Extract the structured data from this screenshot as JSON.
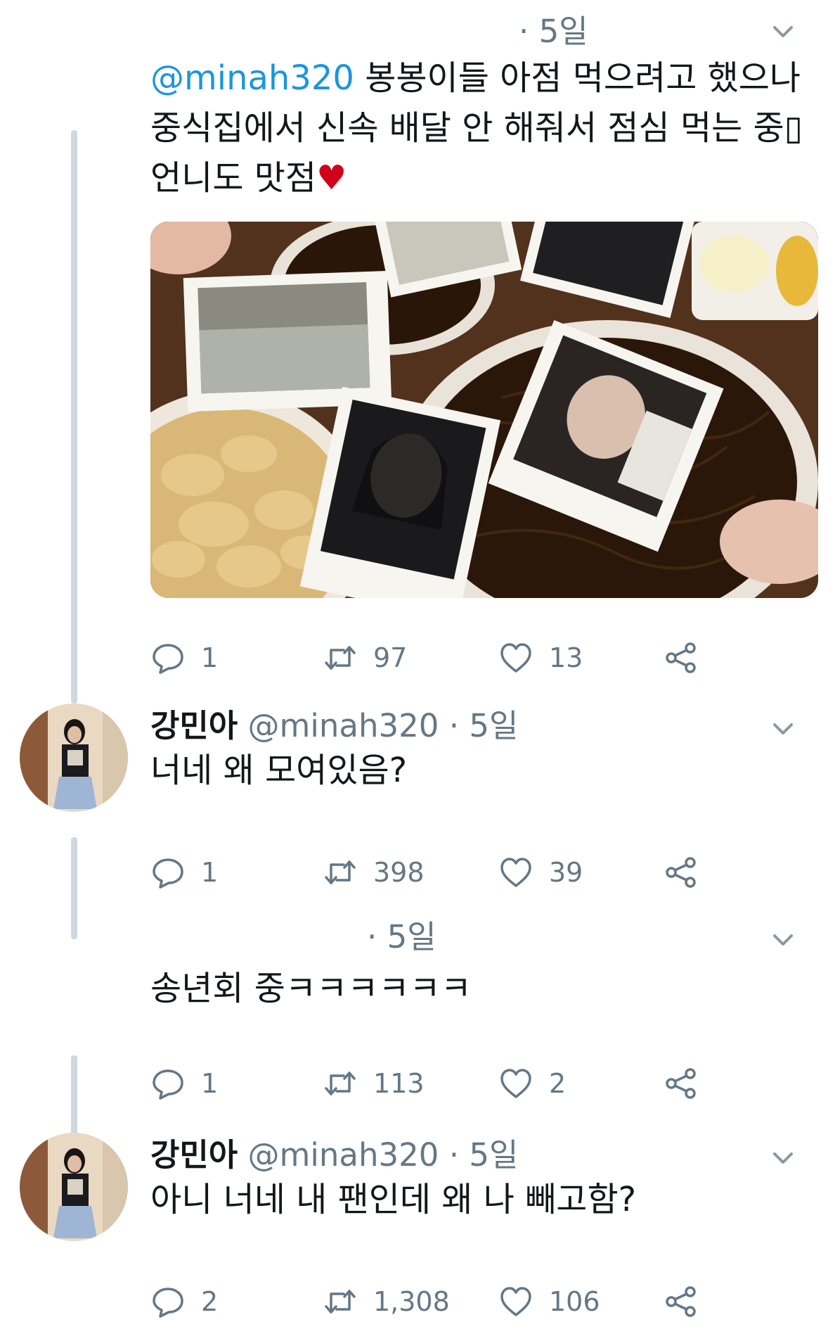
{
  "tweets": [
    {
      "name": "",
      "handle": "",
      "time": "5일",
      "mention": "@minah320",
      "text": "봉봉이들 아점 먹으려고 했으나 중식집에서 신속 배달 안 해줘서 점심 먹는 중▯ 언니도 맛점",
      "emoji": "♥",
      "replies": "1",
      "retweets": "97",
      "likes": "13"
    },
    {
      "name": "강민아",
      "handle": "@minah320",
      "time": "5일",
      "text": "너네 왜 모여있음?",
      "replies": "1",
      "retweets": "398",
      "likes": "39"
    },
    {
      "name": "",
      "handle": "",
      "time": "5일",
      "text": "송년회 중ㅋㅋㅋㅋㅋㅋ",
      "replies": "1",
      "retweets": "113",
      "likes": "2"
    },
    {
      "name": "강민아",
      "handle": "@minah320",
      "time": "5일",
      "text": "아니 너네 내 팬인데 왜 나 빼고함?",
      "replies": "2",
      "retweets": "1,308",
      "likes": "106"
    }
  ],
  "meta": {
    "separator": "·"
  },
  "icons": {
    "reply": "reply-icon",
    "retweet": "retweet-icon",
    "like": "like-icon",
    "share": "share-icon",
    "menu": "chevron-down-icon"
  },
  "colors": {
    "accent": "#1b95e0",
    "muted": "#657786",
    "thread_line": "#cfd8e0",
    "heart": "#d0021b"
  }
}
